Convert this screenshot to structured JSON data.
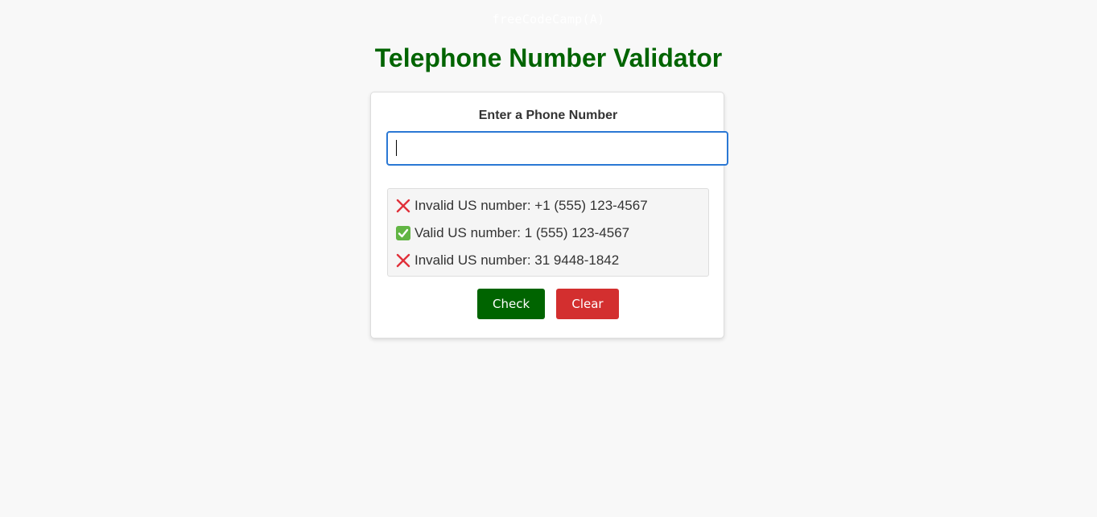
{
  "header": {
    "logo_text": "freeCodeCamp(A)"
  },
  "main": {
    "title": "Telephone Number Validator"
  },
  "form": {
    "label": "Enter a Phone Number",
    "input_value": "",
    "input_placeholder": ""
  },
  "results": [
    {
      "status": "invalid",
      "icon": "cross-mark-icon",
      "text": "Invalid US number: +1 (555) 123-4567"
    },
    {
      "status": "valid",
      "icon": "check-mark-icon",
      "text": "Valid US number: 1 (555) 123-4567"
    },
    {
      "status": "invalid",
      "icon": "cross-mark-icon",
      "text": "Invalid US number: 31 9448-1842"
    }
  ],
  "buttons": {
    "check_label": "Check",
    "clear_label": "Clear"
  },
  "colors": {
    "title": "#006400",
    "check_button": "#006400",
    "clear_button": "#d32f2f",
    "input_border": "#2b78d4",
    "invalid_icon": "#e0303a",
    "valid_icon": "#62b544"
  }
}
